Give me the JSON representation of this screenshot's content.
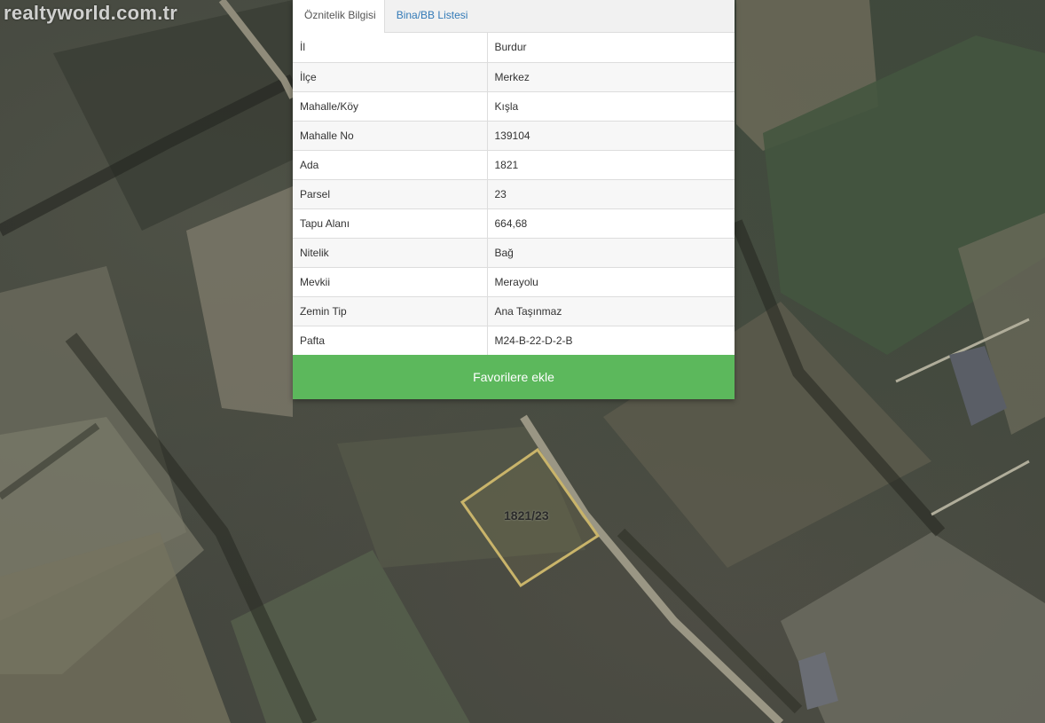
{
  "watermark": "realtyworld.com.tr",
  "tabs": [
    {
      "label": "Öznitelik Bilgisi",
      "active": true
    },
    {
      "label": "Bina/BB Listesi",
      "active": false
    }
  ],
  "attributes": [
    {
      "key": "İl",
      "value": "Burdur"
    },
    {
      "key": "İlçe",
      "value": "Merkez"
    },
    {
      "key": "Mahalle/Köy",
      "value": "Kışla"
    },
    {
      "key": "Mahalle No",
      "value": "139104"
    },
    {
      "key": "Ada",
      "value": "1821"
    },
    {
      "key": "Parsel",
      "value": "23"
    },
    {
      "key": "Tapu Alanı",
      "value": "664,68"
    },
    {
      "key": "Nitelik",
      "value": "Bağ"
    },
    {
      "key": "Mevkii",
      "value": "Merayolu"
    },
    {
      "key": "Zemin Tip",
      "value": "Ana Taşınmaz"
    },
    {
      "key": "Pafta",
      "value": "M24-B-22-D-2-B"
    }
  ],
  "favorite_button": "Favorilere ekle",
  "map": {
    "parcel_label": "1821/23",
    "colors": {
      "accent_green": "#5cb85c",
      "parcel_outline": "#c9b46a",
      "tab_link": "#337ab7"
    }
  }
}
